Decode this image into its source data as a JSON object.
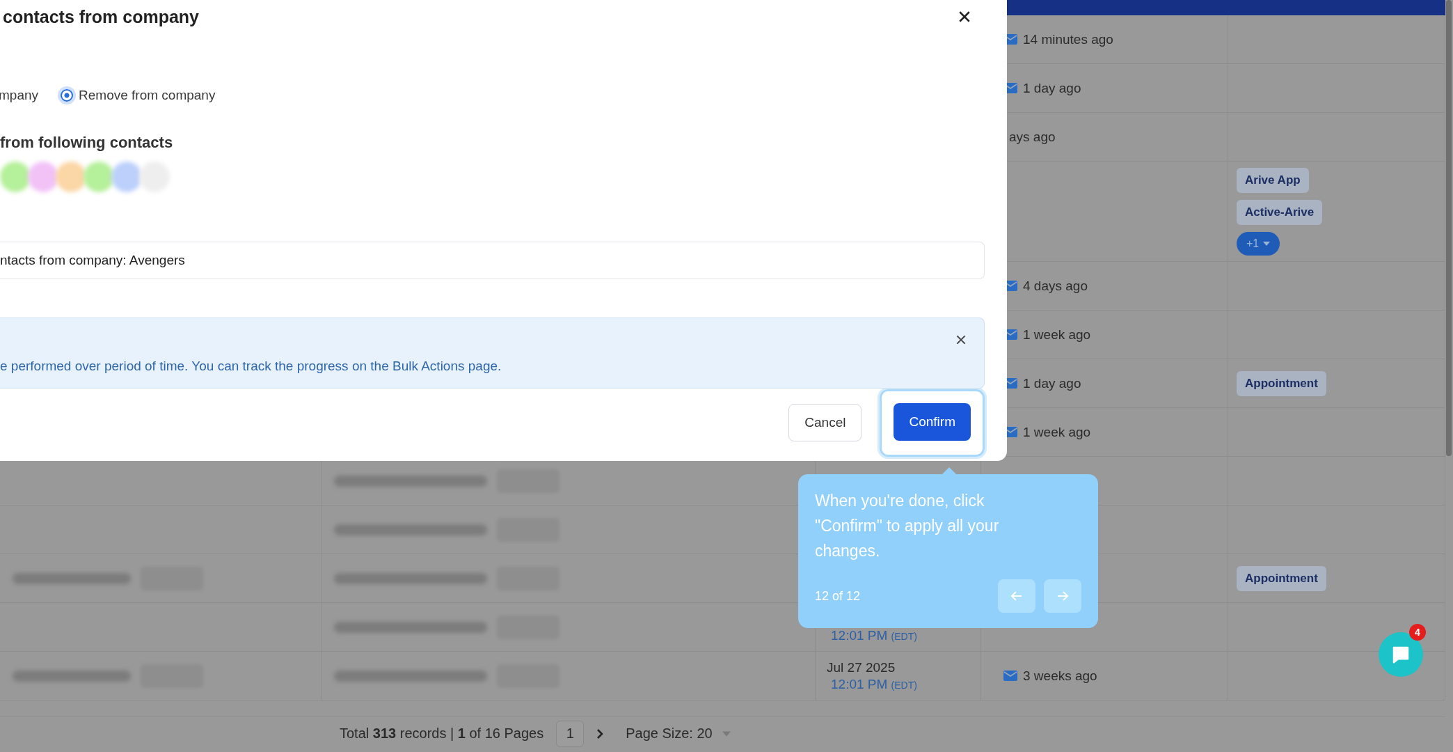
{
  "modal": {
    "title": "contacts from company",
    "radios": [
      {
        "label": "mpany"
      },
      {
        "label": "Remove from company",
        "selected": true
      }
    ],
    "contacts_heading": "from following contacts",
    "avatars": [
      {
        "color": "#b5f09a"
      },
      {
        "color": "#f2c2f7"
      },
      {
        "color": "#fbd6a6"
      },
      {
        "color": "#b5f09a"
      },
      {
        "color": "#bcd0fb"
      },
      {
        "color": "#eeeeee"
      }
    ],
    "note_value": "ntacts from company: Avengers",
    "info": {
      "text": "e performed over period of time. You can track the progress on the Bulk Actions page."
    },
    "buttons": [
      {
        "label": "Cancel",
        "kind": "secondary",
        "highlighted": false
      },
      {
        "label": "Confirm",
        "kind": "primary",
        "highlighted": true
      }
    ]
  },
  "table": {
    "rows": [
      {
        "activity": "14 minutes ago",
        "mail_icon": true,
        "tags": []
      },
      {
        "activity": "1 day ago",
        "mail_icon": true,
        "tags": []
      },
      {
        "activity": "ays ago",
        "mail_icon": false,
        "tags": []
      },
      {
        "tags": [
          "Arive App",
          "Active-Arive"
        ],
        "more": "+1"
      },
      {
        "activity": "4 days ago",
        "mail_icon": true,
        "tags": []
      },
      {
        "activity": "1 week ago",
        "mail_icon": true,
        "tags": []
      },
      {
        "activity": "1 day ago",
        "mail_icon": true,
        "tags": [
          "Appointment"
        ]
      },
      {
        "activity": "1 week ago",
        "mail_icon": true,
        "tags": []
      },
      {
        "email_shown": true,
        "tags": []
      },
      {
        "email_shown": true,
        "tags": []
      },
      {
        "phone_shown": true,
        "email_shown": true,
        "tags": [
          "Appointment"
        ]
      },
      {
        "time": "12:01 PM",
        "tz": "(EDT)",
        "email_shown": true,
        "tags": []
      },
      {
        "date": "Jul 27 2025",
        "time": "12:01 PM",
        "tz": "(EDT)",
        "activity": "3 weeks ago",
        "mail_icon": true,
        "phone_shown": true,
        "email_shown": true,
        "tags": []
      }
    ]
  },
  "pagination": {
    "summary": "Total **313** records | **1** of 16 Pages",
    "page": "1",
    "page_size": "Page Size: 20"
  },
  "tooltip": {
    "text": "When you're done, click \"Confirm\" to apply all your changes.",
    "step": "12 of 12"
  },
  "chat": {
    "badge": "4"
  }
}
